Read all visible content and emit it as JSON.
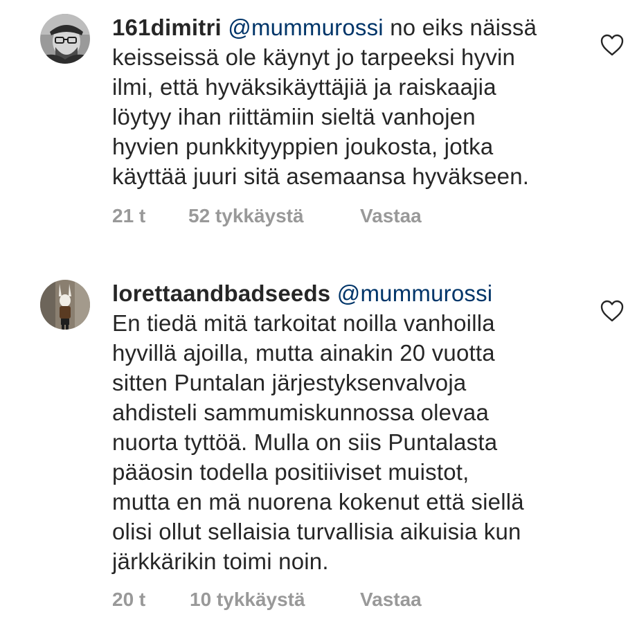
{
  "comments": [
    {
      "username": "161dimitri",
      "mention": "@mummurossi",
      "first_line_rest": "no eiks näissä",
      "lines": [
        "keisseissä ole käynyt jo tarpeeksi hyvin",
        "ilmi, että hyväksikäyttäjiä ja raiskaajia",
        "löytyy ihan riittämiin sieltä vanhojen",
        "hyvien punkkityyppien joukosta, jotka",
        "käyttää juuri sitä asemaansa hyväkseen."
      ],
      "time": "21 t",
      "likes": "52 tykkäystä",
      "reply": "Vastaa",
      "avatar_icon": "bearded-man-with-glasses-avatar",
      "heart_icon": "heart-outline-icon"
    },
    {
      "username": "lorettaandbadseeds",
      "mention": "@mummurossi",
      "first_line_rest": "",
      "lines": [
        "En tiedä mitä tarkoitat noilla vanhoilla",
        "hyvillä ajoilla, mutta ainakin 20 vuotta",
        "sitten Puntalan järjestyksenvalvoja",
        "ahdisteli sammumiskunnossa olevaa",
        "nuorta tyttöä. Mulla on siis Puntalasta",
        "pääosin todella positiiviset muistot,",
        "mutta en mä nuorena kokenut että siellä",
        "olisi ollut sellaisia turvallisia aikuisia kun",
        "järkkärikin toimi noin."
      ],
      "time": "20 t",
      "likes": "10 tykkäystä",
      "reply": "Vastaa",
      "avatar_icon": "rabbit-mask-person-avatar",
      "heart_icon": "heart-outline-icon"
    }
  ],
  "colors": {
    "text": "#262626",
    "mention": "#003569",
    "meta": "#999999",
    "background": "#ffffff"
  }
}
